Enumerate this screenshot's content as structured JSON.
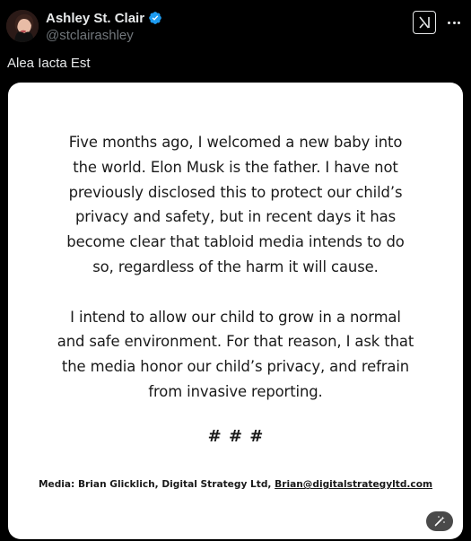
{
  "author": {
    "display_name": "Ashley St. Clair",
    "handle": "@stclairashley",
    "verified": true,
    "verified_color": "#1d9bf0"
  },
  "post": {
    "text": "Alea Iacta Est"
  },
  "media_card": {
    "background": "#ffffff",
    "paragraph_1": [
      "Five months ago, I welcomed a new baby into",
      "the world. Elon Musk is the father. I have not",
      "previously disclosed this to protect our child’s",
      "privacy and safety, but in recent days it has",
      "become clear that tabloid media intends to do",
      "so, regardless of the harm it will cause."
    ],
    "paragraph_2": [
      "I intend to allow our child to grow in a normal",
      "and safe environment. For that reason, I ask that",
      "the media honor our child’s privacy, and refrain",
      "from invasive reporting."
    ],
    "hashes": "# # #",
    "contact_prefix": "Media: Brian Glicklich, Digital Strategy Ltd, ",
    "contact_email": "Brian@digitalstrategyltd.com"
  },
  "icons": {
    "grok": "grok-icon",
    "more": "more-icon",
    "verified": "verified-badge-icon",
    "alt": "magic-wand-icon"
  },
  "colors": {
    "background": "#000000",
    "text_primary": "#e7e9ea",
    "text_secondary": "#71767b"
  }
}
